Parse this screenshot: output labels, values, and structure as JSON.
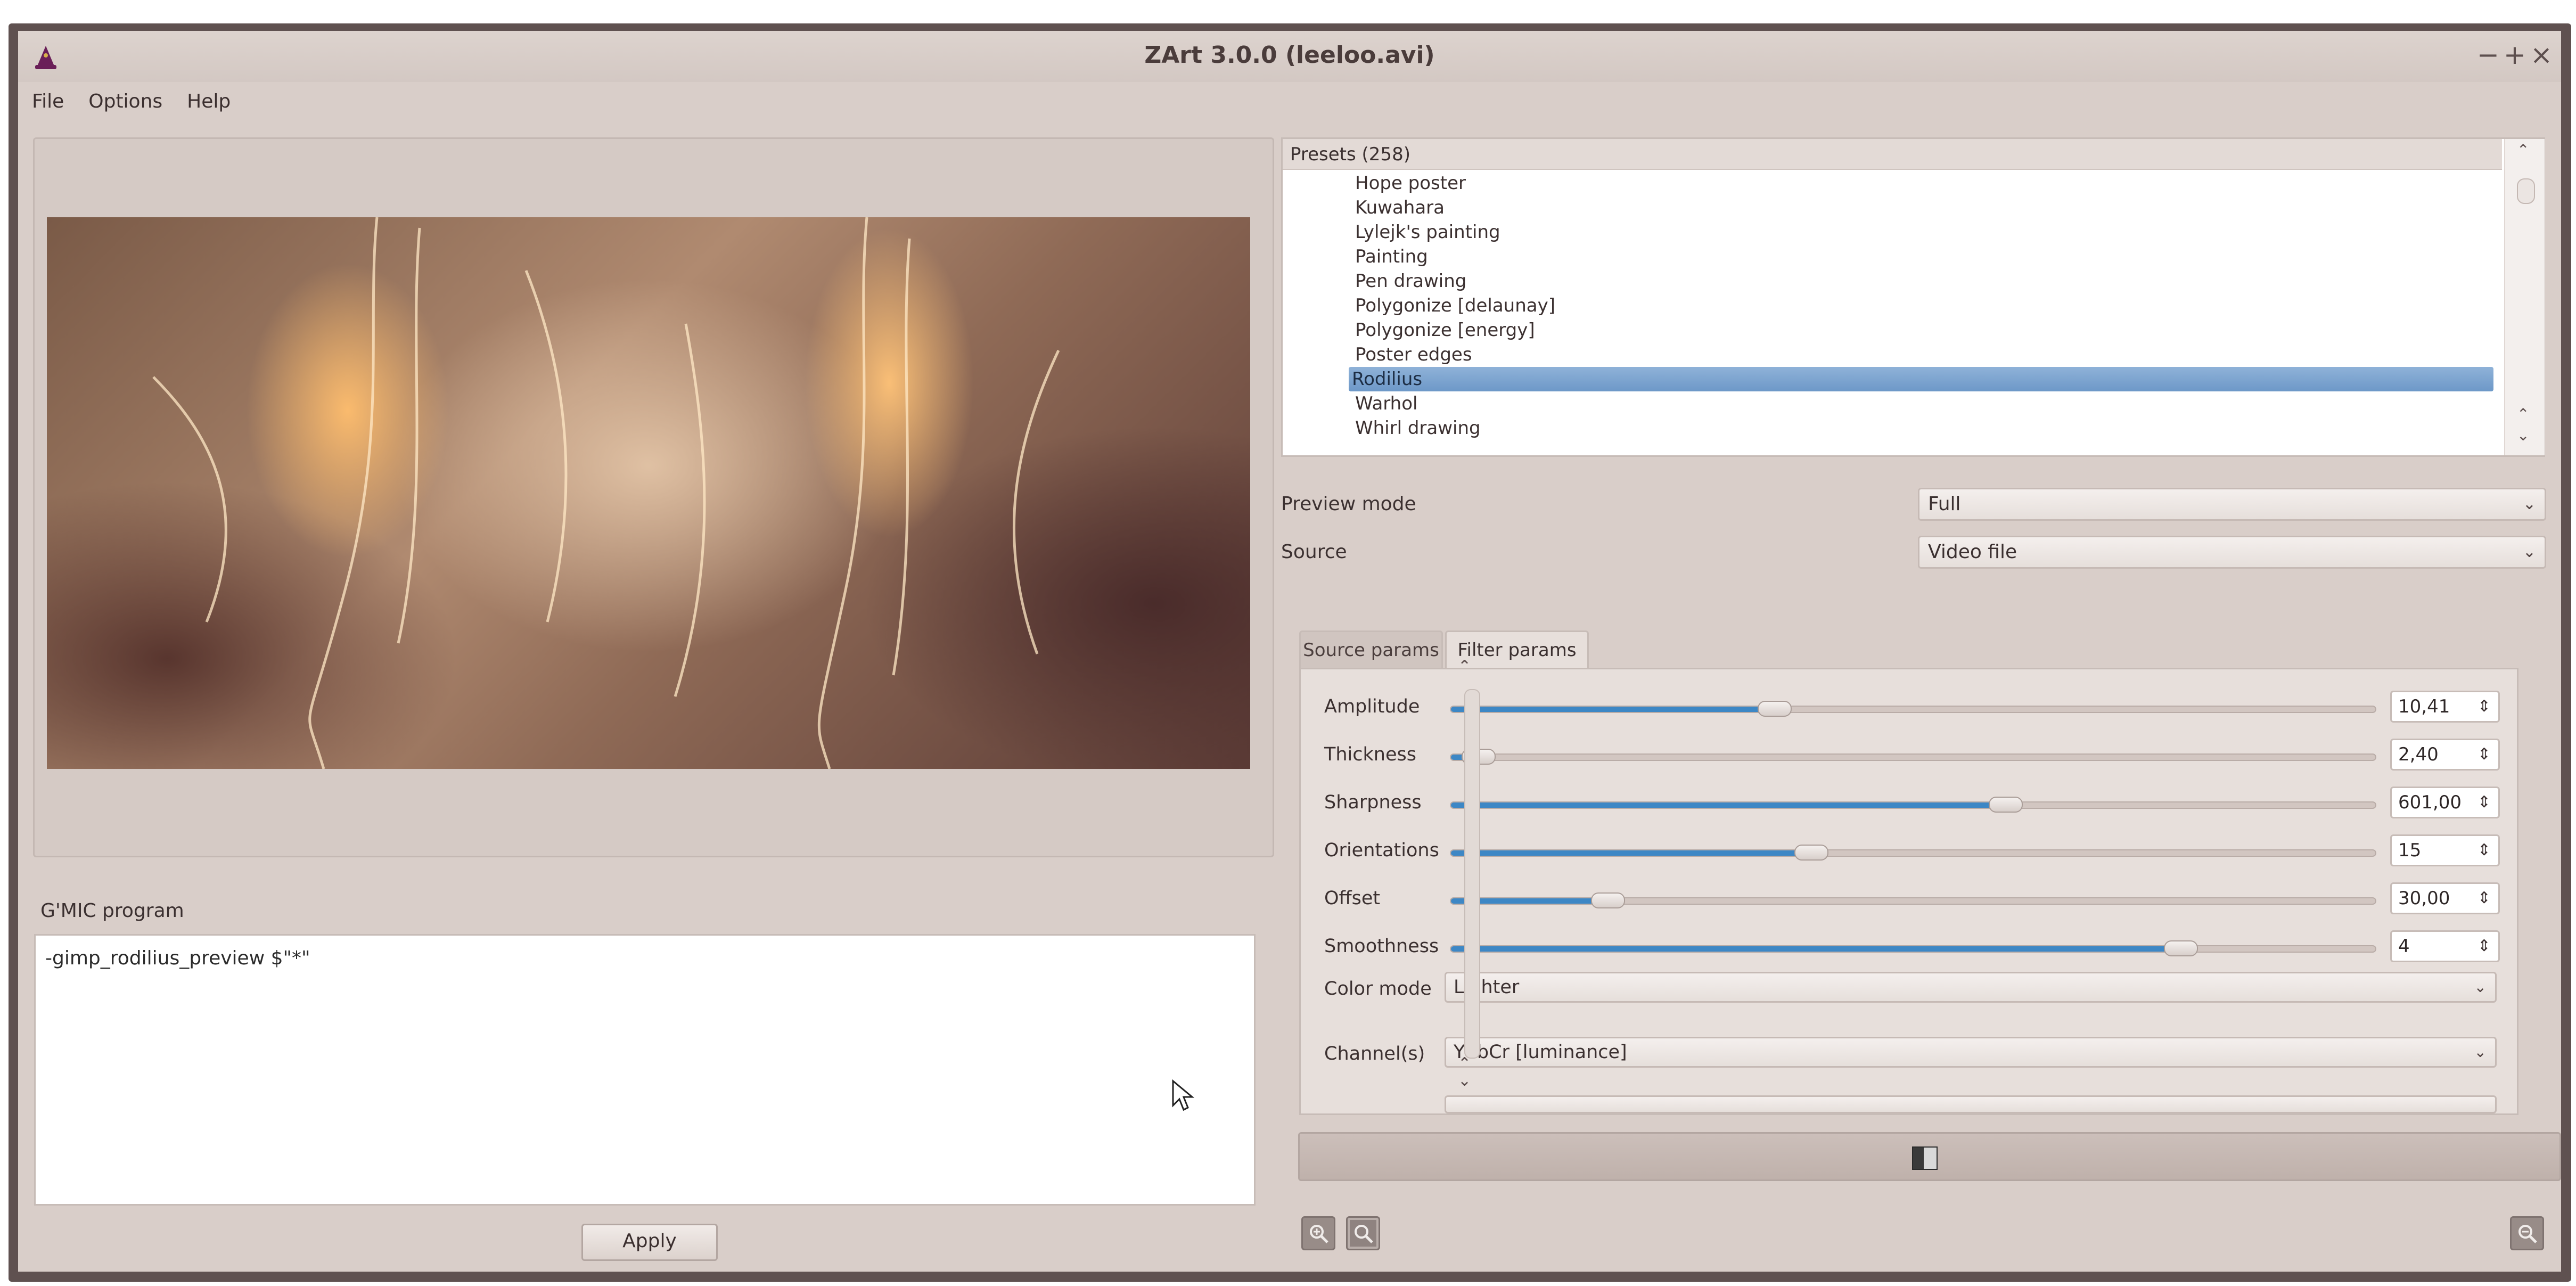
{
  "window": {
    "title": "ZArt 3.0.0 (leeloo.avi)",
    "controls": [
      "−",
      "+",
      "×"
    ]
  },
  "menu": [
    "File",
    "Options",
    "Help"
  ],
  "gmic": {
    "label": "G'MIC program",
    "program": "-gimp_rodilius_preview $\"*\"",
    "apply_label": "Apply"
  },
  "presets": {
    "header": "Presets (258)",
    "items": [
      "Hope poster",
      "Kuwahara",
      "Lylejk's painting",
      "Painting",
      "Pen drawing",
      "Polygonize [delaunay]",
      "Polygonize [energy]",
      "Poster edges",
      "Rodilius",
      "Warhol",
      "Whirl drawing"
    ],
    "selected": "Rodilius"
  },
  "preview_mode": {
    "label": "Preview mode",
    "value": "Full"
  },
  "source": {
    "label": "Source",
    "value": "Video file"
  },
  "tabs": [
    "Source params",
    "Filter params"
  ],
  "active_tab": "Filter params",
  "params": [
    {
      "label": "Amplitude",
      "value": "10,41",
      "fraction": 0.35
    },
    {
      "label": "Thickness",
      "value": "2,40",
      "fraction": 0.03
    },
    {
      "label": "Sharpness",
      "value": "601,00",
      "fraction": 0.6
    },
    {
      "label": "Orientations",
      "value": "15",
      "fraction": 0.39
    },
    {
      "label": "Offset",
      "value": "30,00",
      "fraction": 0.17
    },
    {
      "label": "Smoothness",
      "value": "4",
      "fraction": 0.79
    }
  ],
  "color_mode": {
    "label": "Color mode",
    "value": "Lighter"
  },
  "channels": {
    "label": "Channel(s)",
    "value": "YCbCr [luminance]"
  },
  "colors": {
    "accent": "#3d87c5",
    "window_bg": "#d9cec9",
    "selection": "#7aa3cf"
  },
  "icons": {
    "app": "wizard-hat-icon",
    "zoom": [
      "zoom-in-icon",
      "zoom-fit-icon",
      "zoom-out-icon"
    ],
    "render": "render-icon"
  }
}
